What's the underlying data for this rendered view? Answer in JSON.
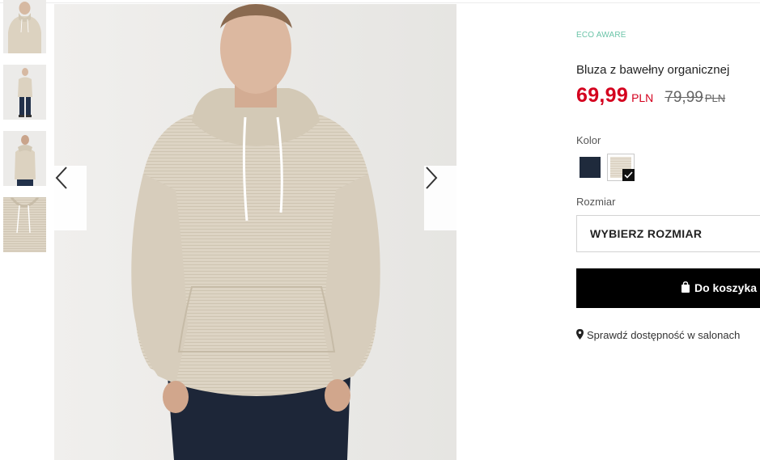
{
  "product": {
    "badge": "ECO AWARE",
    "title": "Bluza z bawełny organicznej",
    "price": "69,99",
    "currency": "PLN",
    "old_price": "79,99",
    "old_currency": "PLN"
  },
  "color": {
    "label": "Kolor",
    "options": [
      {
        "name": "navy",
        "hex": "#1f2a3c",
        "selected": false
      },
      {
        "name": "beige",
        "hex": "#e2dacb",
        "selected": true
      }
    ]
  },
  "size": {
    "label": "Rozmiar",
    "select_text": "WYBIERZ ROZMIAR"
  },
  "cart": {
    "button_label": "Do koszyka"
  },
  "store": {
    "availability_text": "Sprawdź dostępność w salonach"
  },
  "gallery": {
    "thumbnail_count": 4,
    "nav_icons": [
      "chevron-left-icon",
      "chevron-right-icon"
    ]
  },
  "colors": {
    "sale_red": "#d4001e",
    "eco_green": "#6bc4a8",
    "cart_black": "#000000"
  }
}
